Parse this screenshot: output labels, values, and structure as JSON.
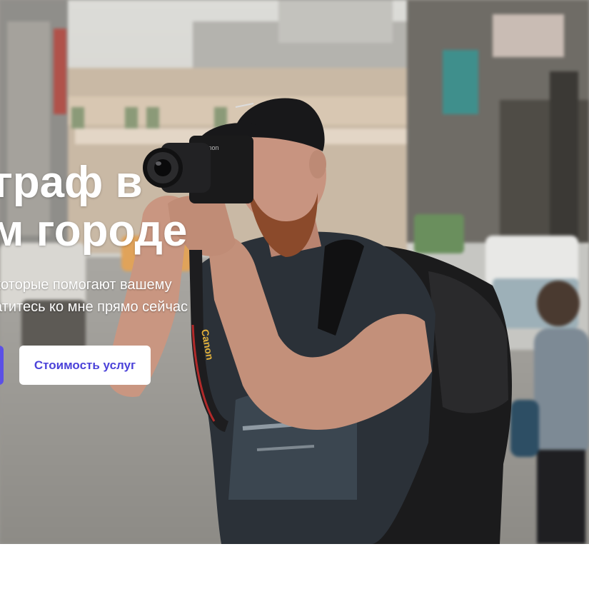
{
  "hero": {
    "headline_line1": "ограф в",
    "headline_line2": "ем городе",
    "subtitle_line1": "которые помогают вашему",
    "subtitle_line2": "атитесь ко мне прямо сейчас",
    "primary_button_label": "",
    "secondary_button_label": "Стоимость услуг",
    "camera_strap_text": "Canon",
    "camera_brand_text": "Canon"
  },
  "colors": {
    "primary_button": "#5b50e6",
    "secondary_button_bg": "#ffffff",
    "secondary_button_text": "#4c43d9",
    "headline_text": "#ffffff",
    "page_background": "#ffffff"
  }
}
